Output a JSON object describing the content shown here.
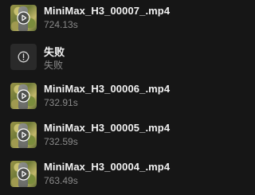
{
  "items": [
    {
      "title": "MiniMax_H3_00007_.mp4",
      "subtitle": "724.13s",
      "kind": "video",
      "icon": "video-thumbnail-icon"
    },
    {
      "title": "失败",
      "subtitle": "失败",
      "kind": "failed",
      "icon": "failure-alert-icon"
    },
    {
      "title": "MiniMax_H3_00006_.mp4",
      "subtitle": "732.91s",
      "kind": "video",
      "icon": "video-thumbnail-icon"
    },
    {
      "title": "MiniMax_H3_00005_.mp4",
      "subtitle": "732.59s",
      "kind": "video",
      "icon": "video-thumbnail-icon"
    },
    {
      "title": "MiniMax_H3_00004_.mp4",
      "subtitle": "763.49s",
      "kind": "video",
      "icon": "video-thumbnail-icon"
    }
  ],
  "colors": {
    "background": "#161616",
    "title": "#f2f2f2",
    "subtitle": "#8a8a8a",
    "fail_icon_bg": "#2a2a2a"
  }
}
